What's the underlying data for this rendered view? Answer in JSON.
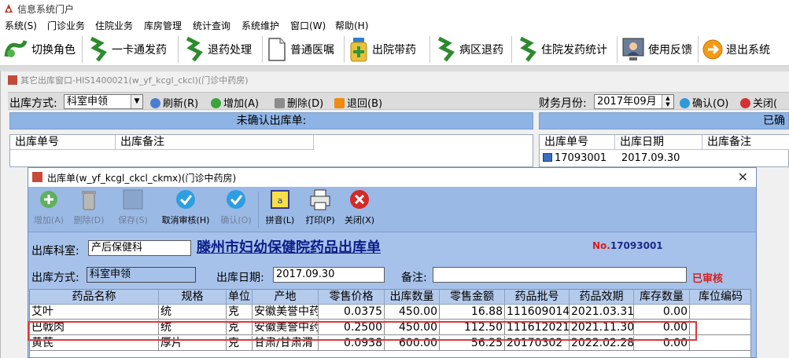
{
  "app": {
    "title": "信息系统门户"
  },
  "menu": [
    "系统(S)",
    "门诊业务",
    "住院业务",
    "库房管理",
    "统计查询",
    "系统维护",
    "窗口(W)",
    "帮助(H)"
  ],
  "toolbar": [
    {
      "label": "切换角色",
      "icon": "switch-role-icon"
    },
    {
      "label": "一卡通发药",
      "icon": "card-dispense-icon"
    },
    {
      "label": "退药处理",
      "icon": "return-drug-icon"
    },
    {
      "label": "普通医嘱",
      "icon": "document-icon"
    },
    {
      "label": "出院带药",
      "icon": "discharge-drug-icon"
    },
    {
      "label": "病区退药",
      "icon": "ward-return-icon"
    },
    {
      "label": "住院发药统计",
      "icon": "stats-icon"
    },
    {
      "label": "使用反馈",
      "icon": "feedback-icon"
    },
    {
      "label": "退出系统",
      "icon": "exit-icon"
    }
  ],
  "parent": {
    "title": "其它出库窗口-HIS1400021(w_yf_kcgl_ckcl)(门诊中药房)",
    "method_label": "出库方式:",
    "method_value": "科室申领",
    "refresh": "刷新(R)",
    "add": "增加(A)",
    "delete": "删除(D)",
    "back": "退回(B)",
    "month_label": "财务月份:",
    "month_value": "2017年09月",
    "confirm": "确认(O)",
    "close": "关闭(",
    "unconfirmed_header": "未确认出库单:",
    "confirmed_header": "已确",
    "left_cols": [
      "出库单号",
      "出库备注"
    ],
    "right_cols": [
      "出库单号",
      "出库日期",
      "出库备注"
    ],
    "right_rows": [
      {
        "no": "17093001",
        "date": "2017.09.30"
      }
    ]
  },
  "dialog": {
    "title": "出库单(w_yf_kcgl_ckcl_ckmx)(门诊中药房)",
    "buttons": [
      {
        "label": "增加(A)",
        "enabled": false
      },
      {
        "label": "删除(D)",
        "enabled": false
      },
      {
        "label": "保存(S)",
        "enabled": false
      },
      {
        "label": "取消审核(H)",
        "enabled": true
      },
      {
        "label": "确认(O)",
        "enabled": false
      },
      {
        "label": "拼音(L)",
        "enabled": true
      },
      {
        "label": "打印(P)",
        "enabled": true
      },
      {
        "label": "关闭(X)",
        "enabled": true
      }
    ],
    "dept_label": "出库科室:",
    "dept_value": "产后保健科",
    "doc_title": "滕州市妇幼保健院药品出库单",
    "no_prefix": "No.",
    "no_value": "17093001",
    "method_label": "出库方式:",
    "method_value": "科室申领",
    "date_label": "出库日期:",
    "date_value": "2017.09.30",
    "remark_label": "备注:",
    "remark_value": "",
    "status": "已审核",
    "columns": [
      "药品名称",
      "规格",
      "单位",
      "产地",
      "零售价格",
      "出库数量",
      "零售金额",
      "药品批号",
      "药品效期",
      "库存数量",
      "库位编码"
    ],
    "rows": [
      [
        "艾叶",
        "统",
        "克",
        "安徽美誉中药",
        "0.0375",
        "450.00",
        "16.88",
        "111609014",
        "2021.03.31",
        "0.00",
        ""
      ],
      [
        "巴戟肉",
        "统",
        "克",
        "安徽美誉中药",
        "0.2500",
        "450.00",
        "112.50",
        "111612021",
        "2021.11.30",
        "0.00",
        ""
      ],
      [
        "黄芪",
        "厚片",
        "克",
        "甘肃/甘肃渭",
        "0.0938",
        "600.00",
        "56.25",
        "20170302",
        "2022.02.28",
        "0.00",
        ""
      ]
    ]
  },
  "colors": {
    "dialog_bg": "#a7c2ea",
    "accent_red": "#d42020",
    "title_blue": "#0b1e8a"
  }
}
